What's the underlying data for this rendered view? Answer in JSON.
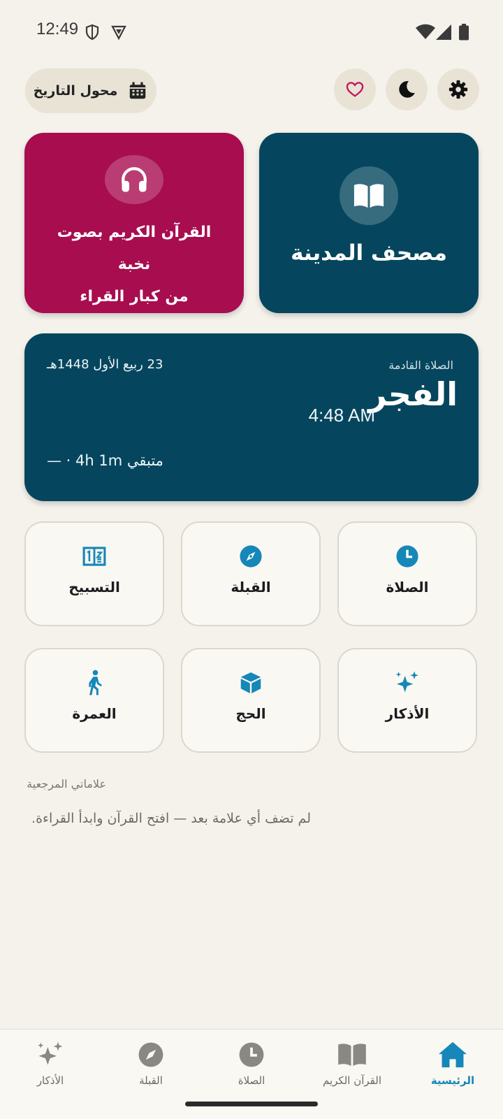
{
  "status_bar": {
    "time": "12:49",
    "icons": [
      "shield-icon",
      "vpn-icon",
      "wifi-icon",
      "signal-icon",
      "battery-icon"
    ]
  },
  "top_bar": {
    "date_converter_label": "محول التاريخ",
    "buttons": [
      "favorites-heart-icon",
      "dark-mode-moon-icon",
      "settings-gear-icon"
    ]
  },
  "cards": {
    "mushaf_title": "مصحف المدينة",
    "audio_line1": "القرآن الكريم بصوت نخبة",
    "audio_line2": "من كبار القراء"
  },
  "prayer": {
    "next_label": "الصلاة القادمة",
    "hijri_date": "23 ربيع الأول 1448هـ",
    "name": "الفجر",
    "time": "4:48 AM",
    "remaining": "متبقي 4h 1m · —"
  },
  "grid": {
    "row1": [
      "الصلاة",
      "القبلة",
      "التسبيح"
    ],
    "row2": [
      "الأذكار",
      "الحج",
      "العمرة"
    ]
  },
  "bookmarks": {
    "title": "علاماتي المرجعية",
    "empty": "لم تضف أي علامة بعد — افتح القرآن وابدأ القراءة."
  },
  "nav": {
    "home": "الرئيسية",
    "quran": "القرآن الكريم",
    "prayer": "الصلاة",
    "qibla": "القبلة",
    "adhkar": "الأذكار",
    "active": "home"
  },
  "colors": {
    "accent": "#1587b8",
    "primary_card": "#05465e",
    "audio_card": "#a80d4f",
    "background": "#f5f2ec"
  }
}
